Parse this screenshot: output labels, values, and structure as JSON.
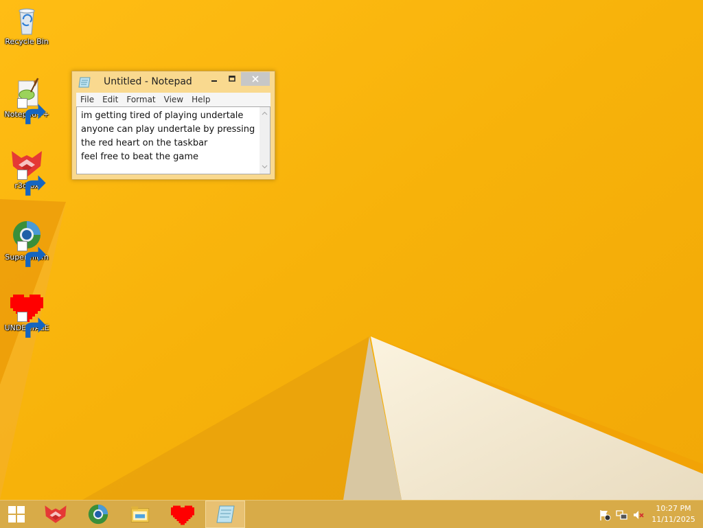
{
  "desktop": {
    "icons": [
      {
        "label": "Recycle Bin",
        "icon": "recycle-bin-icon"
      },
      {
        "label": "Notepad++",
        "icon": "notepad-plus-plus-icon"
      },
      {
        "label": "r3dfox",
        "icon": "r3dfox-icon"
      },
      {
        "label": "Supermium",
        "icon": "supermium-icon"
      },
      {
        "label": "UNDERTALE",
        "icon": "undertale-heart-icon"
      }
    ]
  },
  "notepad": {
    "title": "Untitled - Notepad",
    "menu": [
      "File",
      "Edit",
      "Format",
      "View",
      "Help"
    ],
    "lines": [
      "im getting tired of playing undertale",
      "anyone can play undertale by pressing",
      "the red heart on the taskbar",
      "feel free to beat the game"
    ]
  },
  "taskbar": {
    "items": [
      "start-button",
      "r3dfox",
      "supermium",
      "file-explorer",
      "undertale",
      "notepad"
    ],
    "tray": [
      "action-center-flag-icon",
      "network-icon",
      "volume-muted-icon"
    ],
    "clock": {
      "time": "10:27 PM",
      "date": "11/11/2025"
    }
  },
  "colors": {
    "wallpaper": "#f6b00c",
    "taskbar": "#d8ab48",
    "undertale_heart": "#ff0000"
  }
}
